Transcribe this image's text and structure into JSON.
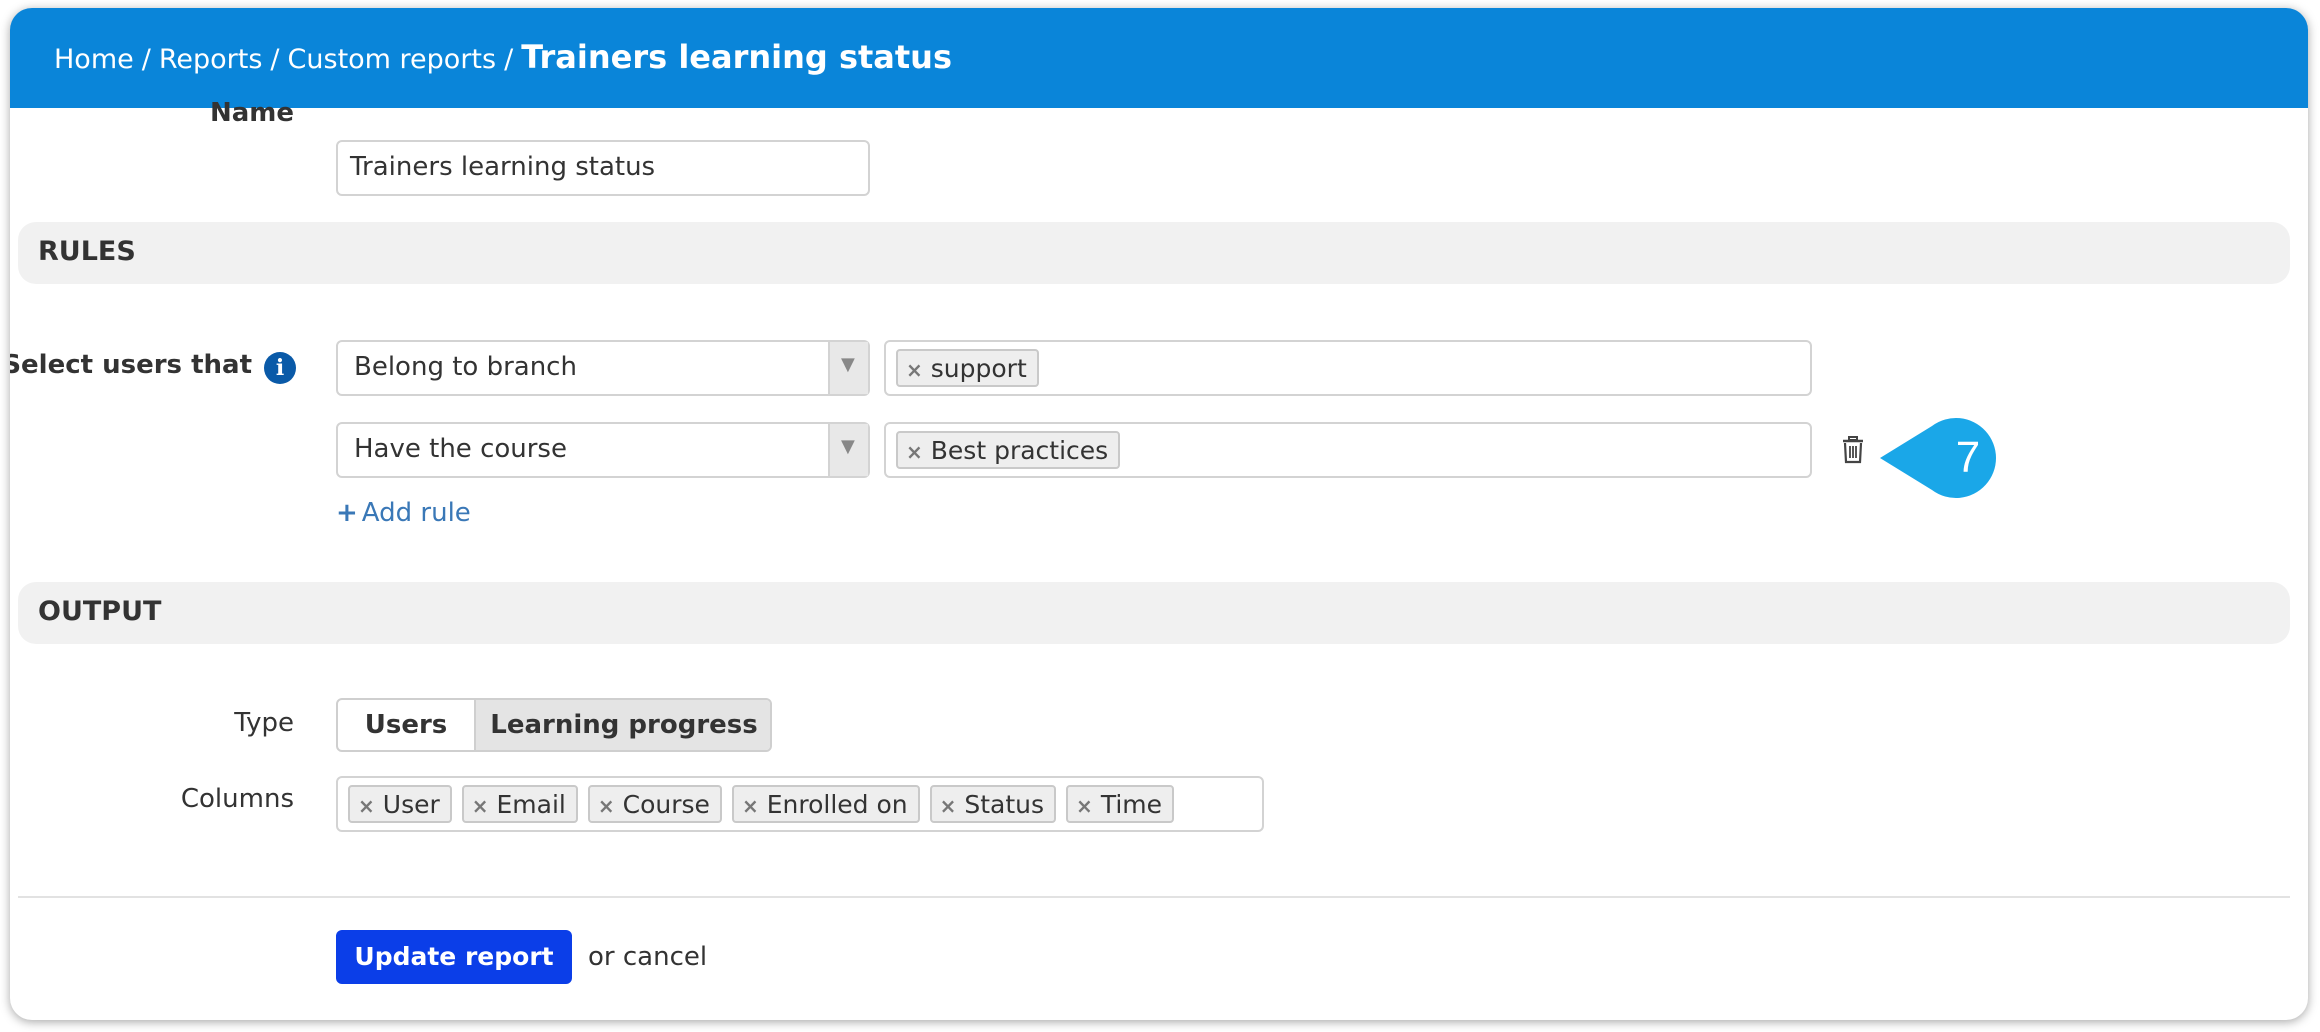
{
  "breadcrumb": {
    "home": "Home",
    "reports": "Reports",
    "custom_reports": "Custom reports",
    "separator": "/",
    "current": "Trainers learning status"
  },
  "name_field": {
    "label": "Name",
    "value": "Trainers learning status"
  },
  "rules": {
    "heading": "RULES",
    "select_users_label": "Select users that",
    "info_icon": "i",
    "rows": [
      {
        "condition": "Belong to branch",
        "tags": [
          "support"
        ]
      },
      {
        "condition": "Have the course",
        "tags": [
          "Best practices"
        ]
      }
    ],
    "add_rule_plus": "+",
    "add_rule_label": "Add rule",
    "callout_number": "7"
  },
  "output": {
    "heading": "OUTPUT",
    "type_label": "Type",
    "type_options": [
      "Users",
      "Learning progress"
    ],
    "type_selected": "Learning progress",
    "columns_label": "Columns",
    "columns": [
      "User",
      "Email",
      "Course",
      "Enrolled on",
      "Status",
      "Time"
    ]
  },
  "actions": {
    "update_label": "Update report",
    "cancel_label": "or cancel"
  },
  "icons": {
    "tag_remove": "×",
    "select_arrow": "▼",
    "trash": "trash-icon"
  },
  "colors": {
    "header": "#0a85d9",
    "primary_button": "#0b3ee8",
    "link": "#3a78b7",
    "callout": "#1aa7e8"
  }
}
